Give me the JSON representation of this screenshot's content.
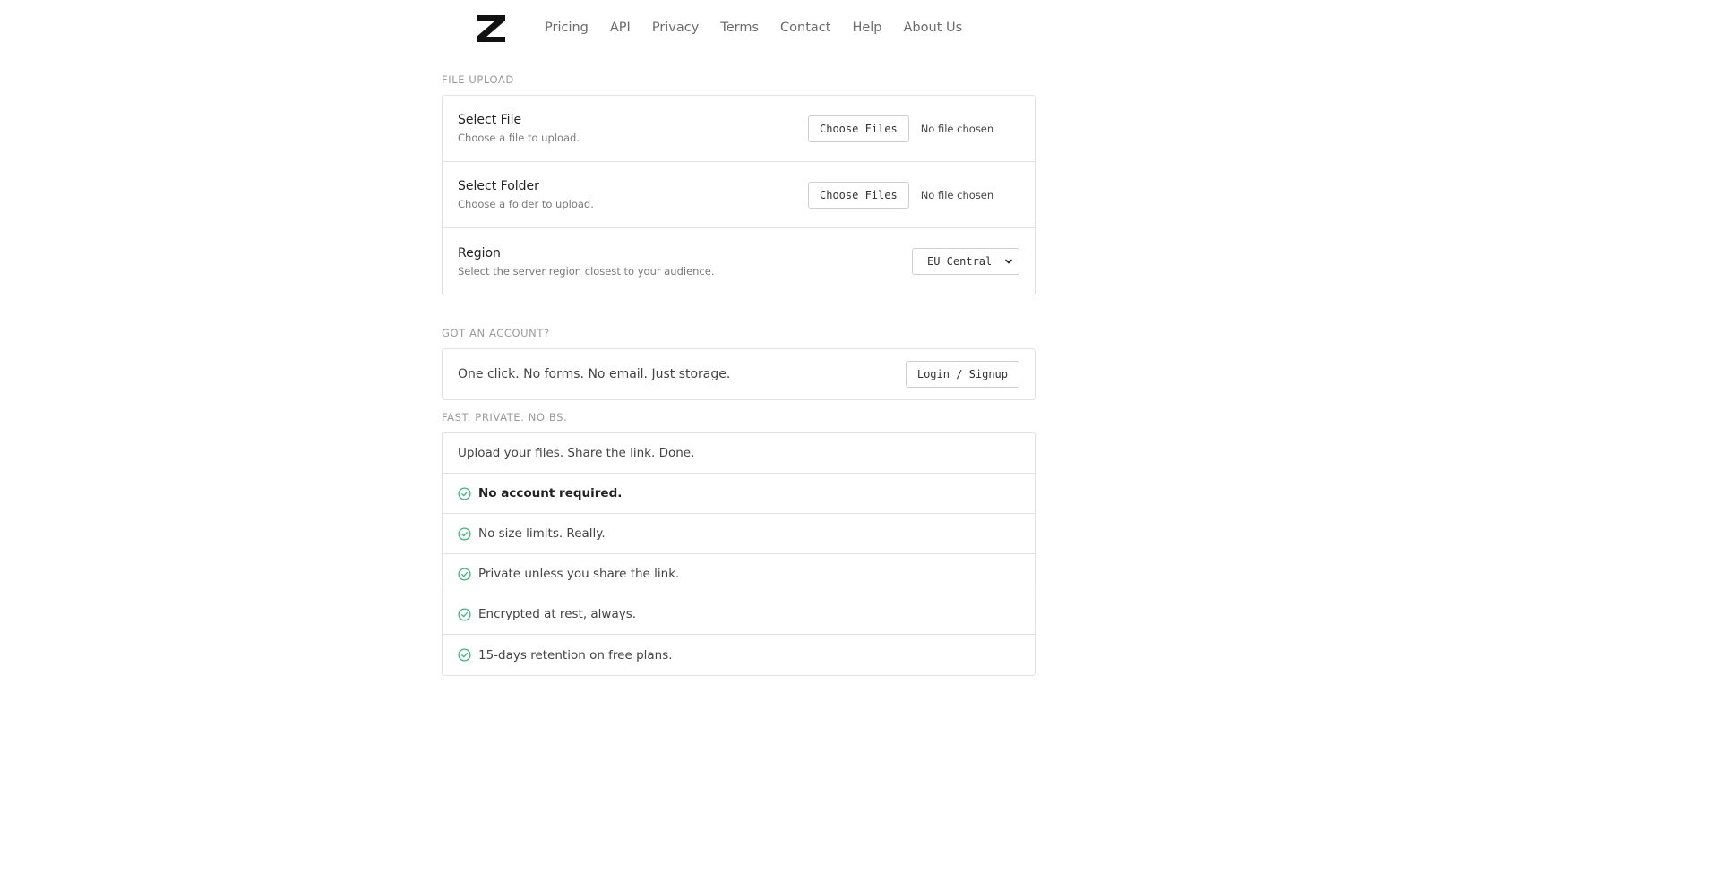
{
  "header": {
    "logo_alt": "Z",
    "nav": [
      "Pricing",
      "API",
      "Privacy",
      "Terms",
      "Contact",
      "Help",
      "About Us"
    ]
  },
  "upload_section": {
    "title": "FILE UPLOAD",
    "rows": [
      {
        "title": "Select File",
        "description": "Choose a file to upload.",
        "button_label": "Choose Files",
        "status": "No file chosen"
      },
      {
        "title": "Select Folder",
        "description": "Choose a folder to upload.",
        "button_label": "Choose Files",
        "status": "No file chosen"
      }
    ],
    "region": {
      "title": "Region",
      "description": "Select the server region closest to your audience.",
      "selected": "EU Central"
    }
  },
  "account_section": {
    "title": "GOT AN ACCOUNT?",
    "text": "One click. No forms. No email. Just storage.",
    "button_label": "Login / Signup"
  },
  "features_section": {
    "title": "FAST. PRIVATE. NO BS.",
    "intro": "Upload your files. Share the link. Done.",
    "items": [
      "No account required.",
      "No size limits. Really.",
      "Private unless you share the link.",
      "Encrypted at rest, always.",
      "15-days retention on free plans."
    ]
  },
  "colors": {
    "check_green": "#3cb878",
    "border": "#e2e2e2",
    "section_title": "#9a9a9a"
  }
}
